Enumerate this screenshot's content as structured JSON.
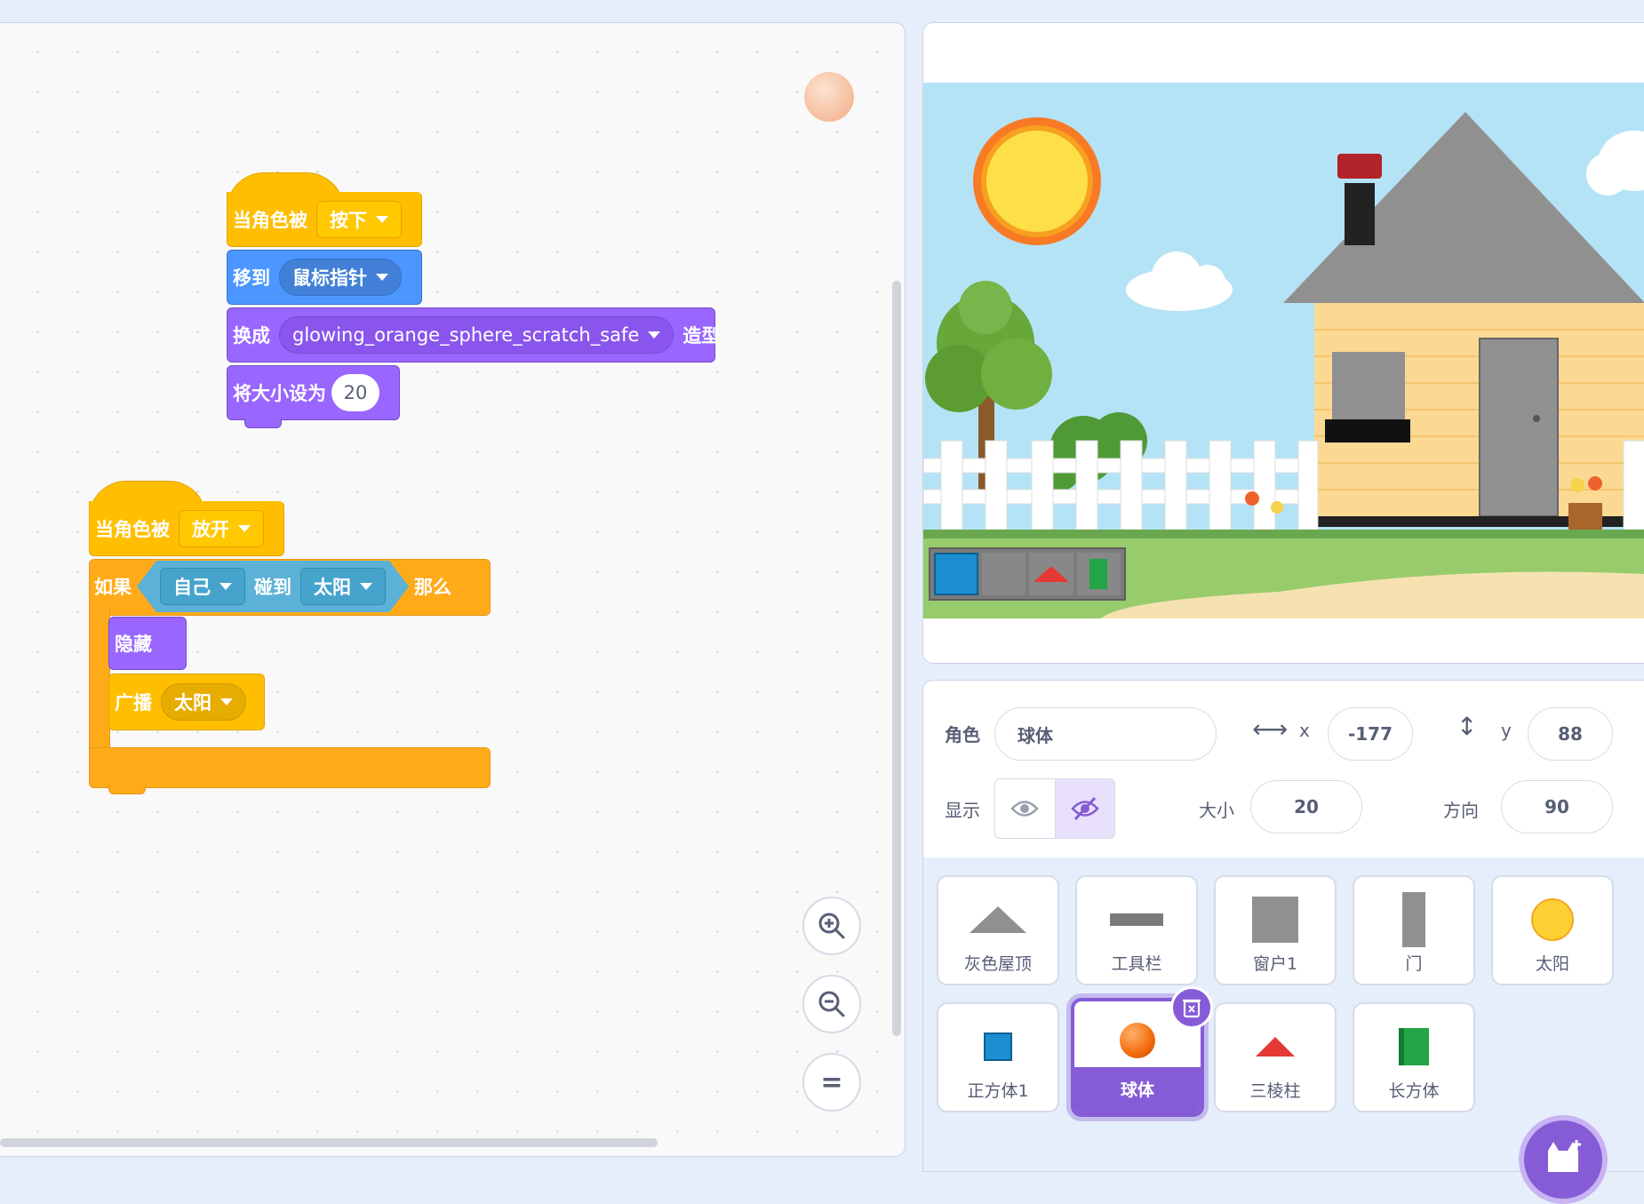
{
  "code": {
    "script1": {
      "when_sprite": "当角色被",
      "when_option": "按下",
      "goto_label": "移到",
      "goto_option": "鼠标指针",
      "switch_label": "换成",
      "costume_option": "glowing_orange_sphere_scratch_safe",
      "costume_suffix": "造型",
      "setsize_label": "将大小设为",
      "setsize_value": "20"
    },
    "script2": {
      "when_sprite": "当角色被",
      "when_option": "放开",
      "if_label": "如果",
      "touch_self": "自己",
      "touch_label": "碰到",
      "touch_target": "太阳",
      "then_label": "那么",
      "hide_label": "隐藏",
      "broadcast_label": "广播",
      "broadcast_option": "太阳"
    },
    "zoom": {
      "in_icon": "zoom-in-icon",
      "out_icon": "zoom-out-icon",
      "reset_icon": "zoom-reset-icon",
      "reset_glyph": "="
    }
  },
  "stage": {
    "toolbar_icons": [
      "blue-cube-icon",
      "gray-square-icon",
      "red-prism-icon",
      "green-cuboid-icon"
    ]
  },
  "sprite_info": {
    "sprite_label": "角色",
    "sprite_name": "球体",
    "x_label": "x",
    "x_value": "-177",
    "y_label": "y",
    "y_value": "88",
    "show_label": "显示",
    "size_label": "大小",
    "size_value": "20",
    "direction_label": "方向",
    "direction_value": "90"
  },
  "sprites": [
    {
      "name": "灰色屋顶",
      "icon": "roof-icon"
    },
    {
      "name": "工具栏",
      "icon": "toolbar-icon"
    },
    {
      "name": "窗户1",
      "icon": "window-icon"
    },
    {
      "name": "门",
      "icon": "door-icon"
    },
    {
      "name": "太阳",
      "icon": "sun-icon"
    },
    {
      "name": "正方体1",
      "icon": "cube-icon"
    },
    {
      "name": "球体",
      "icon": "sphere-icon",
      "selected": true
    },
    {
      "name": "三棱柱",
      "icon": "prism-icon"
    },
    {
      "name": "长方体",
      "icon": "cuboid-icon"
    }
  ],
  "colors": {
    "events": "#ffbf00",
    "motion": "#4c97ff",
    "looks": "#9966ff",
    "control": "#ffab19",
    "sensing": "#5cb1d6",
    "selected": "#855cd6"
  }
}
